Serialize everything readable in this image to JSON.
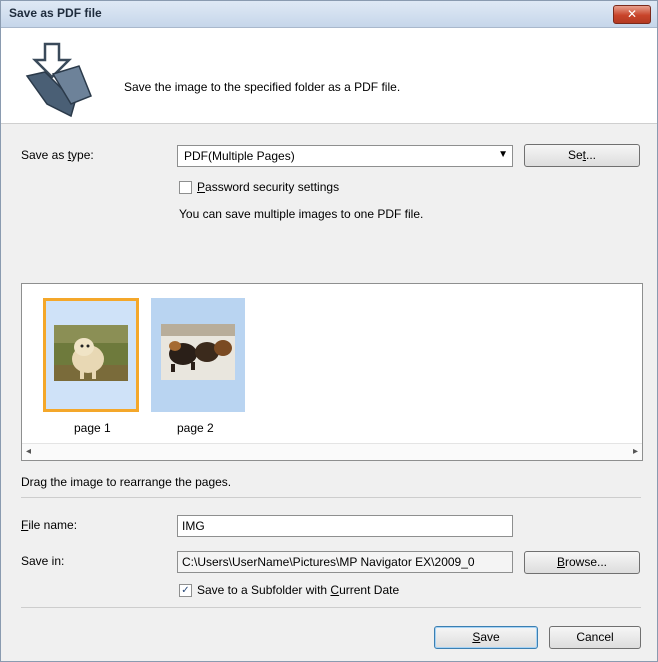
{
  "window": {
    "title": "Save as PDF file",
    "close_glyph": "✕"
  },
  "header": {
    "icon": "save-to-folder-icon",
    "description": "Save the image to the specified folder as a PDF file."
  },
  "save_type": {
    "label_pre": "Save as ",
    "label_u": "t",
    "label_post": "ype:",
    "selected": "PDF(Multiple Pages)",
    "set_pre": "Se",
    "set_u": "t",
    "set_post": "..."
  },
  "password": {
    "checked": false,
    "label_u": "P",
    "label_post": "assword security settings"
  },
  "info_text": "You can save multiple images to one PDF file.",
  "pages": [
    {
      "label": "page 1",
      "selected": true
    },
    {
      "label": "page 2",
      "selected": false
    }
  ],
  "drag_hint": "Drag the image to rearrange the pages.",
  "file_name": {
    "label_u": "F",
    "label_post": "ile name:",
    "value": "IMG"
  },
  "save_in": {
    "label": "Save in:",
    "value": "C:\\Users\\UserName\\Pictures\\MP Navigator EX\\2009_0",
    "browse_u": "B",
    "browse_post": "rowse..."
  },
  "subfolder": {
    "checked": true,
    "label_pre": "Save to a Subfolder with ",
    "label_u": "C",
    "label_post": "urrent Date"
  },
  "buttons": {
    "save_u": "S",
    "save_post": "ave",
    "cancel": "Cancel"
  }
}
